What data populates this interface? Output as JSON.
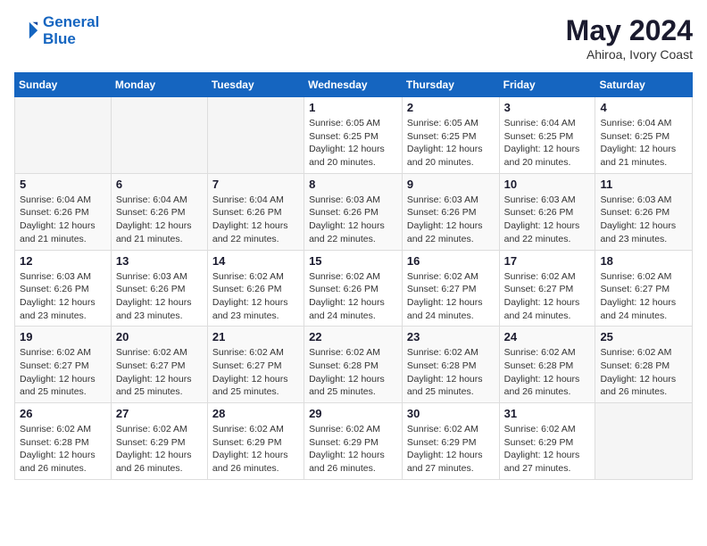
{
  "header": {
    "logo_line1": "General",
    "logo_line2": "Blue",
    "month_year": "May 2024",
    "location": "Ahiroa, Ivory Coast"
  },
  "weekdays": [
    "Sunday",
    "Monday",
    "Tuesday",
    "Wednesday",
    "Thursday",
    "Friday",
    "Saturday"
  ],
  "weeks": [
    [
      {
        "day": "",
        "info": ""
      },
      {
        "day": "",
        "info": ""
      },
      {
        "day": "",
        "info": ""
      },
      {
        "day": "1",
        "info": "Sunrise: 6:05 AM\nSunset: 6:25 PM\nDaylight: 12 hours\nand 20 minutes."
      },
      {
        "day": "2",
        "info": "Sunrise: 6:05 AM\nSunset: 6:25 PM\nDaylight: 12 hours\nand 20 minutes."
      },
      {
        "day": "3",
        "info": "Sunrise: 6:04 AM\nSunset: 6:25 PM\nDaylight: 12 hours\nand 20 minutes."
      },
      {
        "day": "4",
        "info": "Sunrise: 6:04 AM\nSunset: 6:25 PM\nDaylight: 12 hours\nand 21 minutes."
      }
    ],
    [
      {
        "day": "5",
        "info": "Sunrise: 6:04 AM\nSunset: 6:26 PM\nDaylight: 12 hours\nand 21 minutes."
      },
      {
        "day": "6",
        "info": "Sunrise: 6:04 AM\nSunset: 6:26 PM\nDaylight: 12 hours\nand 21 minutes."
      },
      {
        "day": "7",
        "info": "Sunrise: 6:04 AM\nSunset: 6:26 PM\nDaylight: 12 hours\nand 22 minutes."
      },
      {
        "day": "8",
        "info": "Sunrise: 6:03 AM\nSunset: 6:26 PM\nDaylight: 12 hours\nand 22 minutes."
      },
      {
        "day": "9",
        "info": "Sunrise: 6:03 AM\nSunset: 6:26 PM\nDaylight: 12 hours\nand 22 minutes."
      },
      {
        "day": "10",
        "info": "Sunrise: 6:03 AM\nSunset: 6:26 PM\nDaylight: 12 hours\nand 22 minutes."
      },
      {
        "day": "11",
        "info": "Sunrise: 6:03 AM\nSunset: 6:26 PM\nDaylight: 12 hours\nand 23 minutes."
      }
    ],
    [
      {
        "day": "12",
        "info": "Sunrise: 6:03 AM\nSunset: 6:26 PM\nDaylight: 12 hours\nand 23 minutes."
      },
      {
        "day": "13",
        "info": "Sunrise: 6:03 AM\nSunset: 6:26 PM\nDaylight: 12 hours\nand 23 minutes."
      },
      {
        "day": "14",
        "info": "Sunrise: 6:02 AM\nSunset: 6:26 PM\nDaylight: 12 hours\nand 23 minutes."
      },
      {
        "day": "15",
        "info": "Sunrise: 6:02 AM\nSunset: 6:26 PM\nDaylight: 12 hours\nand 24 minutes."
      },
      {
        "day": "16",
        "info": "Sunrise: 6:02 AM\nSunset: 6:27 PM\nDaylight: 12 hours\nand 24 minutes."
      },
      {
        "day": "17",
        "info": "Sunrise: 6:02 AM\nSunset: 6:27 PM\nDaylight: 12 hours\nand 24 minutes."
      },
      {
        "day": "18",
        "info": "Sunrise: 6:02 AM\nSunset: 6:27 PM\nDaylight: 12 hours\nand 24 minutes."
      }
    ],
    [
      {
        "day": "19",
        "info": "Sunrise: 6:02 AM\nSunset: 6:27 PM\nDaylight: 12 hours\nand 25 minutes."
      },
      {
        "day": "20",
        "info": "Sunrise: 6:02 AM\nSunset: 6:27 PM\nDaylight: 12 hours\nand 25 minutes."
      },
      {
        "day": "21",
        "info": "Sunrise: 6:02 AM\nSunset: 6:27 PM\nDaylight: 12 hours\nand 25 minutes."
      },
      {
        "day": "22",
        "info": "Sunrise: 6:02 AM\nSunset: 6:28 PM\nDaylight: 12 hours\nand 25 minutes."
      },
      {
        "day": "23",
        "info": "Sunrise: 6:02 AM\nSunset: 6:28 PM\nDaylight: 12 hours\nand 25 minutes."
      },
      {
        "day": "24",
        "info": "Sunrise: 6:02 AM\nSunset: 6:28 PM\nDaylight: 12 hours\nand 26 minutes."
      },
      {
        "day": "25",
        "info": "Sunrise: 6:02 AM\nSunset: 6:28 PM\nDaylight: 12 hours\nand 26 minutes."
      }
    ],
    [
      {
        "day": "26",
        "info": "Sunrise: 6:02 AM\nSunset: 6:28 PM\nDaylight: 12 hours\nand 26 minutes."
      },
      {
        "day": "27",
        "info": "Sunrise: 6:02 AM\nSunset: 6:29 PM\nDaylight: 12 hours\nand 26 minutes."
      },
      {
        "day": "28",
        "info": "Sunrise: 6:02 AM\nSunset: 6:29 PM\nDaylight: 12 hours\nand 26 minutes."
      },
      {
        "day": "29",
        "info": "Sunrise: 6:02 AM\nSunset: 6:29 PM\nDaylight: 12 hours\nand 26 minutes."
      },
      {
        "day": "30",
        "info": "Sunrise: 6:02 AM\nSunset: 6:29 PM\nDaylight: 12 hours\nand 27 minutes."
      },
      {
        "day": "31",
        "info": "Sunrise: 6:02 AM\nSunset: 6:29 PM\nDaylight: 12 hours\nand 27 minutes."
      },
      {
        "day": "",
        "info": ""
      }
    ]
  ]
}
